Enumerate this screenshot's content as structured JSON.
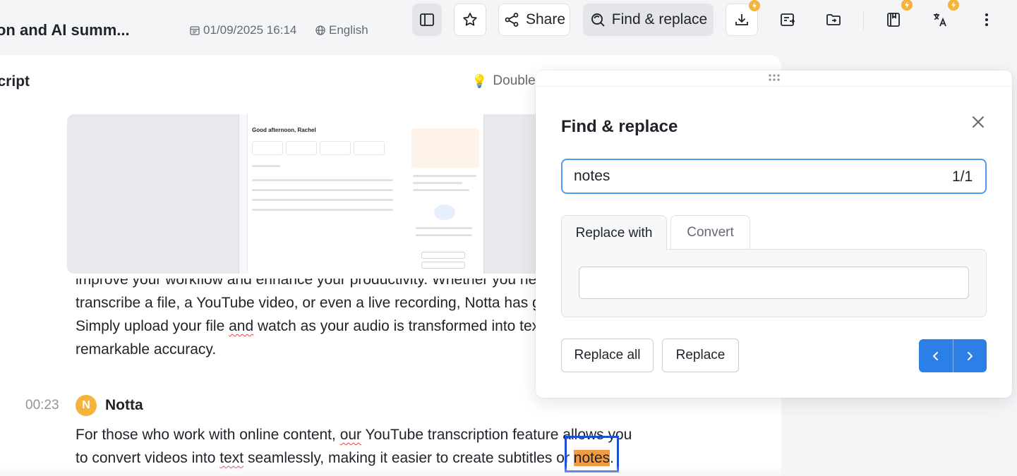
{
  "header": {
    "title": "iption and AI summ...",
    "date": "01/09/2025 16:14",
    "language": "English",
    "toolbar": {
      "share_label": "Share",
      "find_replace_label": "Find & replace",
      "icons": [
        "sidebar-toggle-icon",
        "star-icon",
        "share-icon",
        "find-replace-icon",
        "download-icon",
        "export-icon",
        "folder-icon",
        "notebook-icon",
        "translate-icon",
        "more-icon"
      ]
    }
  },
  "transcript": {
    "section_title": "nscript",
    "tip_text": "Double-",
    "paragraph_1": {
      "line_1": "improve your workflow and enhance your productivity. Whether you ne",
      "line_2": "transcribe a file, a YouTube video, or even a live recording, Notta has g",
      "line_3_a": "Simply upload your file ",
      "line_3_b": "and",
      "line_3_c": " watch as your audio is transformed into tex",
      "line_4": "remarkable accuracy."
    },
    "segment": {
      "timestamp": "00:23",
      "avatar_letter": "N",
      "speaker": "Notta",
      "line_1_a": "For those who work with online content, ",
      "line_1_b": "our",
      "line_1_c": " YouTube transcription feature allows you",
      "line_2_a": "to convert videos into ",
      "line_2_b": "text",
      "line_2_c": " seamlessly, making it easier to create subtitles or ",
      "line_2_match": "notes",
      "line_2_end": "."
    },
    "video_thumb": {
      "greeting": "Good afternoon, Rachel"
    }
  },
  "find_replace": {
    "title": "Find & replace",
    "find_value": "notes",
    "match_count": "1/1",
    "tabs": [
      "Replace with",
      "Convert"
    ],
    "active_tab": "Replace with",
    "replace_value": "",
    "replace_all_label": "Replace all",
    "replace_label": "Replace"
  },
  "colors": {
    "accent": "#2b7fe6",
    "highlight": "#f29b43",
    "premium": "#f5b33b",
    "focus_border": "#4c9bf0"
  }
}
